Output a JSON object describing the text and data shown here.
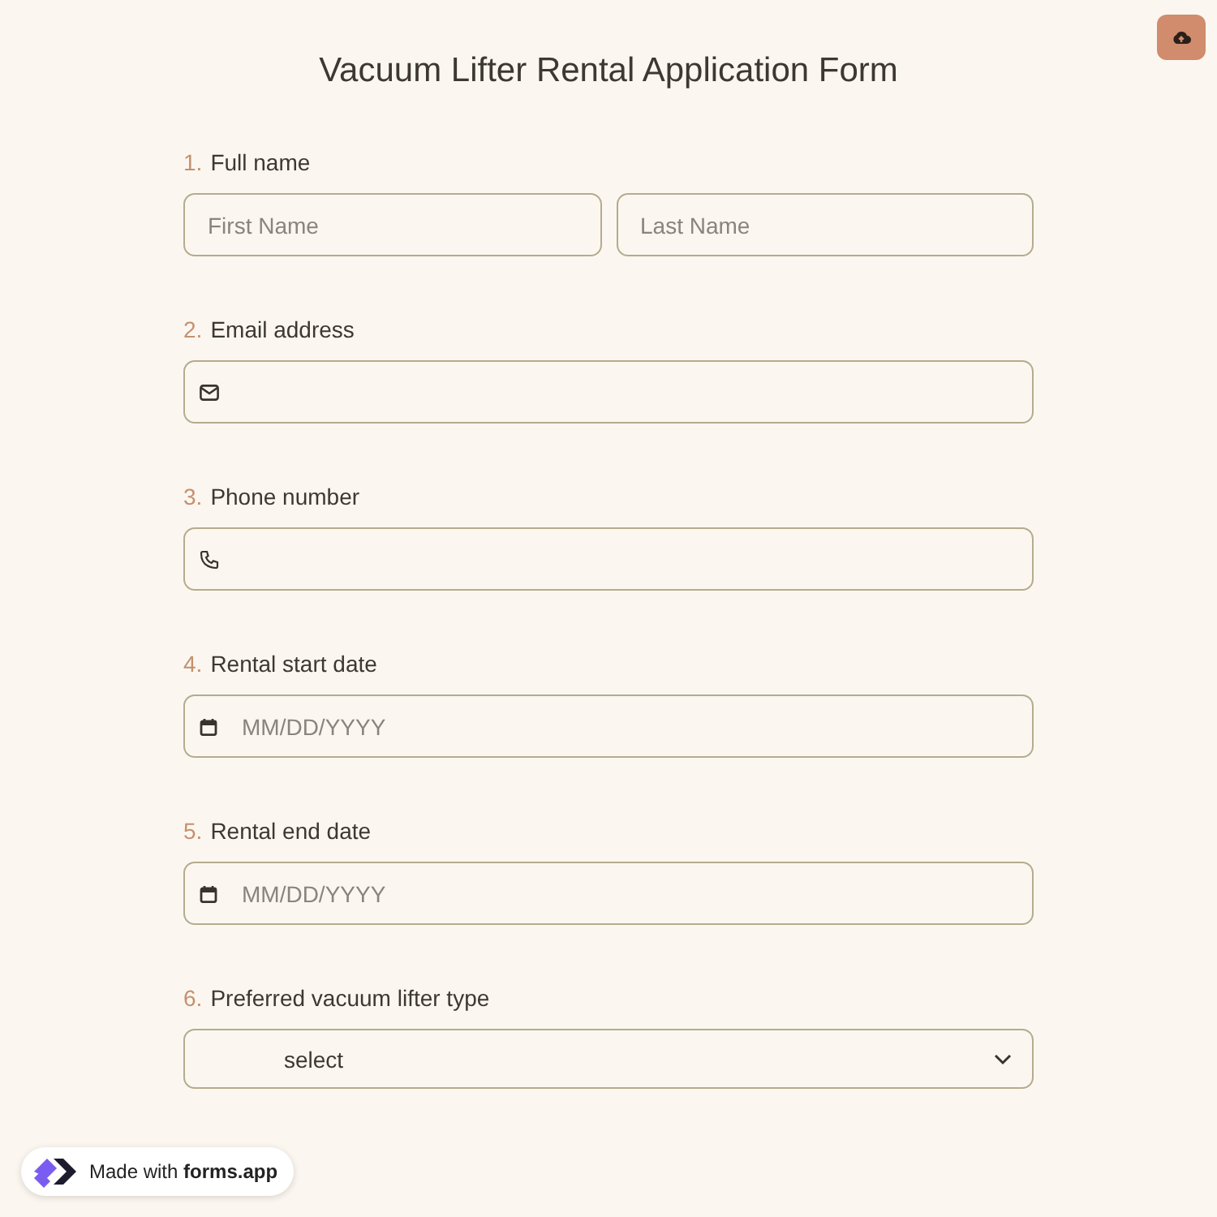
{
  "title": "Vacuum Lifter Rental Application Form",
  "questions": [
    {
      "number": "1.",
      "label": "Full name",
      "kind": "name",
      "placeholders": [
        "First Name",
        "Last Name"
      ]
    },
    {
      "number": "2.",
      "label": "Email address",
      "kind": "email"
    },
    {
      "number": "3.",
      "label": "Phone number",
      "kind": "phone"
    },
    {
      "number": "4.",
      "label": "Rental start date",
      "kind": "date",
      "placeholder": "MM/DD/YYYY"
    },
    {
      "number": "5.",
      "label": "Rental end date",
      "kind": "date",
      "placeholder": "MM/DD/YYYY"
    },
    {
      "number": "6.",
      "label": "Preferred vacuum lifter type",
      "kind": "select",
      "value": "select"
    }
  ],
  "badge": {
    "prefix": "Made with",
    "brand": "forms.app"
  }
}
